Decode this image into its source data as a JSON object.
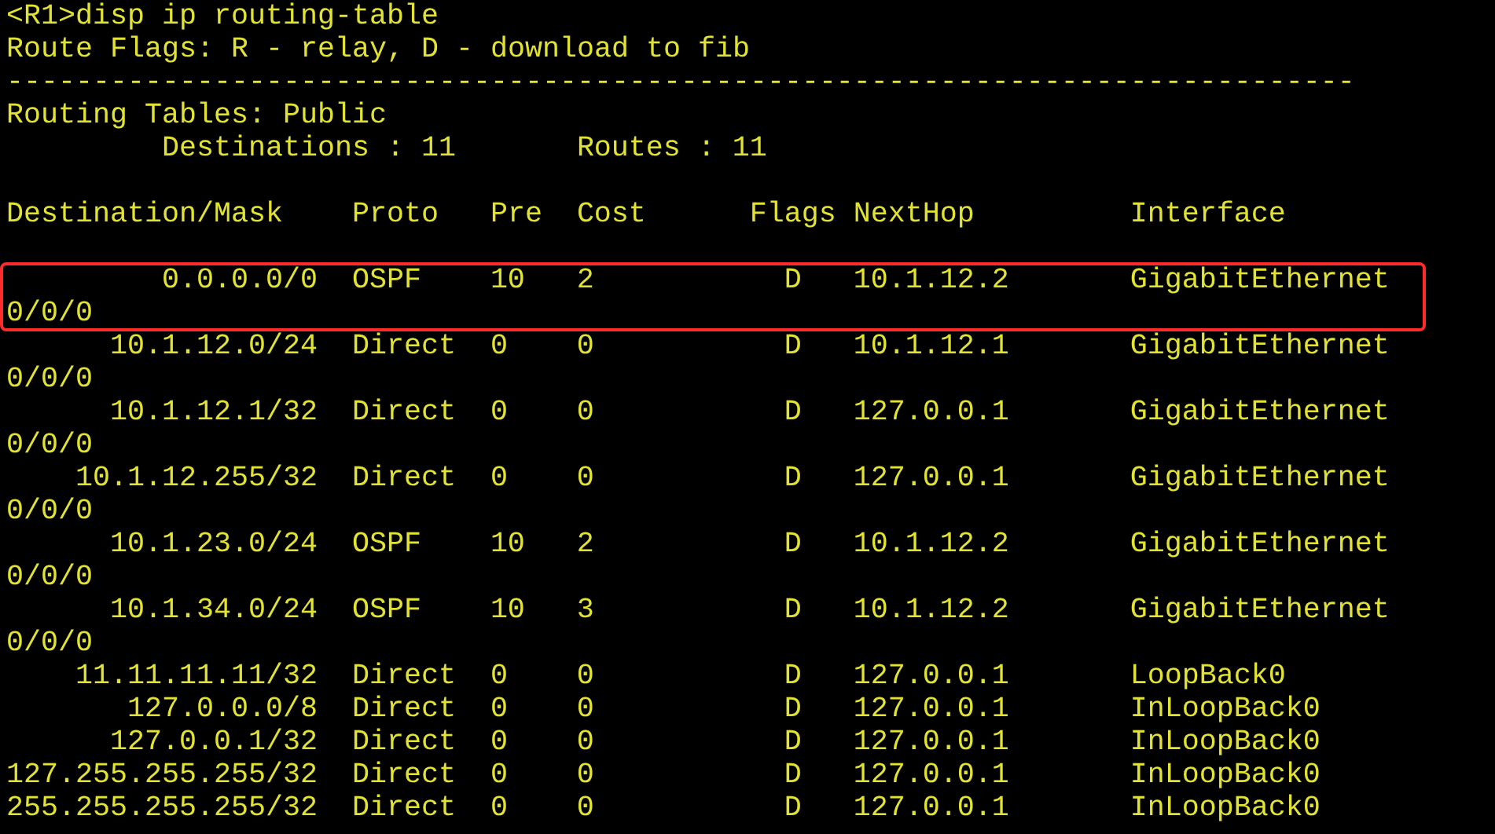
{
  "command": {
    "prompt": "<R1>",
    "text": "disp ip routing-table"
  },
  "route_flags": "Route Flags: R - relay, D - download to fib",
  "separator": "------------------------------------------------------------------------------",
  "routing_tables": "Routing Tables: Public",
  "summary": {
    "destinations": "Destinations : 11",
    "routes": "Routes : 11"
  },
  "table": {
    "columns": [
      "Destination/Mask",
      "Proto",
      "Pre",
      "Cost",
      "Flags",
      "NextHop",
      "Interface"
    ],
    "rows": [
      {
        "destination": "0.0.0.0/0",
        "proto": "OSPF",
        "pre": "10",
        "cost": "2",
        "flags": "D",
        "nexthop": "10.1.12.2",
        "interface": "GigabitEthernet",
        "interface_wrap": "0/0/0",
        "highlighted": true
      },
      {
        "destination": "10.1.12.0/24",
        "proto": "Direct",
        "pre": "0",
        "cost": "0",
        "flags": "D",
        "nexthop": "10.1.12.1",
        "interface": "GigabitEthernet",
        "interface_wrap": "0/0/0",
        "highlighted": false
      },
      {
        "destination": "10.1.12.1/32",
        "proto": "Direct",
        "pre": "0",
        "cost": "0",
        "flags": "D",
        "nexthop": "127.0.0.1",
        "interface": "GigabitEthernet",
        "interface_wrap": "0/0/0",
        "highlighted": false
      },
      {
        "destination": "10.1.12.255/32",
        "proto": "Direct",
        "pre": "0",
        "cost": "0",
        "flags": "D",
        "nexthop": "127.0.0.1",
        "interface": "GigabitEthernet",
        "interface_wrap": "0/0/0",
        "highlighted": false
      },
      {
        "destination": "10.1.23.0/24",
        "proto": "OSPF",
        "pre": "10",
        "cost": "2",
        "flags": "D",
        "nexthop": "10.1.12.2",
        "interface": "GigabitEthernet",
        "interface_wrap": "0/0/0",
        "highlighted": false
      },
      {
        "destination": "10.1.34.0/24",
        "proto": "OSPF",
        "pre": "10",
        "cost": "3",
        "flags": "D",
        "nexthop": "10.1.12.2",
        "interface": "GigabitEthernet",
        "interface_wrap": "0/0/0",
        "highlighted": false
      },
      {
        "destination": "11.11.11.11/32",
        "proto": "Direct",
        "pre": "0",
        "cost": "0",
        "flags": "D",
        "nexthop": "127.0.0.1",
        "interface": "LoopBack0",
        "highlighted": false
      },
      {
        "destination": "127.0.0.0/8",
        "proto": "Direct",
        "pre": "0",
        "cost": "0",
        "flags": "D",
        "nexthop": "127.0.0.1",
        "interface": "InLoopBack0",
        "highlighted": false
      },
      {
        "destination": "127.0.0.1/32",
        "proto": "Direct",
        "pre": "0",
        "cost": "0",
        "flags": "D",
        "nexthop": "127.0.0.1",
        "interface": "InLoopBack0",
        "highlighted": false
      },
      {
        "destination": "127.255.255.255/32",
        "proto": "Direct",
        "pre": "0",
        "cost": "0",
        "flags": "D",
        "nexthop": "127.0.0.1",
        "interface": "InLoopBack0",
        "highlighted": false
      },
      {
        "destination": "255.255.255.255/32",
        "proto": "Direct",
        "pre": "0",
        "cost": "0",
        "flags": "D",
        "nexthop": "127.0.0.1",
        "interface": "InLoopBack0",
        "highlighted": false
      }
    ]
  }
}
